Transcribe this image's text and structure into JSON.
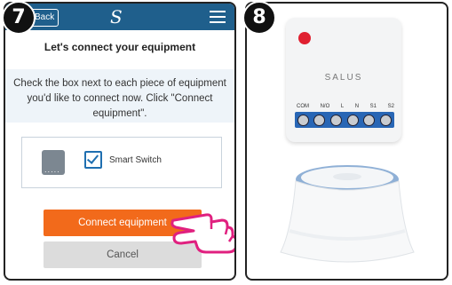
{
  "badges": {
    "left": "7",
    "right": "8"
  },
  "header": {
    "back_label": "Back",
    "logo": "S",
    "menu_icon": "hamburger-icon"
  },
  "screen": {
    "title": "Let's connect your equipment",
    "instructions": "Check the box next to each piece of equipment you'd like to connect now. Click \"Connect equipment\"."
  },
  "device": {
    "label": "Smart Switch",
    "checked": true
  },
  "buttons": {
    "connect": "Connect equipment",
    "cancel": "Cancel"
  },
  "product": {
    "brand": "SALUS",
    "terminals": [
      "COM",
      "N/O",
      "L",
      "N",
      "S1",
      "S2"
    ]
  },
  "colors": {
    "header": "#1f5f8c",
    "accent": "#f26a1b",
    "terminal_block": "#2866b5",
    "led": "#e02030"
  }
}
